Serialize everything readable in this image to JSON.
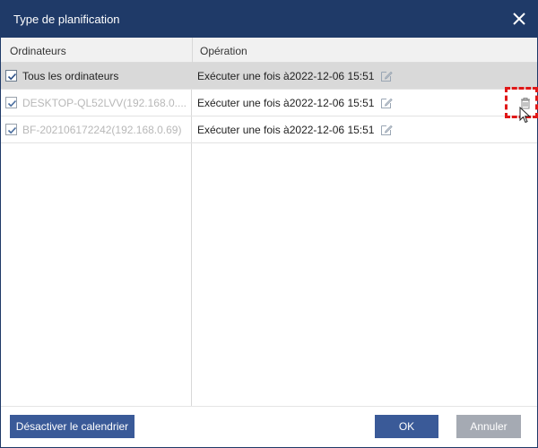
{
  "dialog": {
    "title": "Type de planification"
  },
  "table": {
    "columns": [
      "Ordinateurs",
      "Opération"
    ],
    "rows": [
      {
        "name": "Tous les ordinateurs",
        "operation": "Exécuter une fois à2022-12-06 15:51",
        "checked": true,
        "dimmed": false
      },
      {
        "name": "DESKTOP-QL52LVV(192.168.0....",
        "operation": "Exécuter une fois à2022-12-06 15:51",
        "checked": true,
        "dimmed": true
      },
      {
        "name": "BF-202106172242(192.168.0.69)",
        "operation": "Exécuter une fois à2022-12-06 15:51",
        "checked": true,
        "dimmed": true
      }
    ]
  },
  "footer": {
    "disable_calendar_label": "Désactiver le calendrier",
    "ok_label": "OK",
    "cancel_label": "Annuler"
  },
  "colors": {
    "titlebar": "#1f3a68",
    "primary_button": "#3a5a98",
    "disabled_button": "#a5aab3",
    "highlight": "#e01818",
    "selected_row": "#d9d9d9"
  },
  "icons": {
    "close": "close-icon",
    "edit": "edit-icon",
    "delete": "trash-icon",
    "cursor": "mouse-pointer-icon"
  }
}
